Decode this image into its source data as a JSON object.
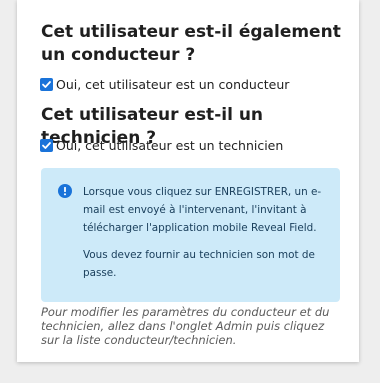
{
  "driver_section": {
    "heading": "Cet utilisateur est-il également un conducteur ?",
    "checkbox_label": "Oui, cet utilisateur est un conducteur",
    "checked": true
  },
  "technician_section": {
    "heading": "Cet utilisateur est-il un technicien ?",
    "checkbox_label": "Oui, cet utilisateur est un technicien",
    "checked": true
  },
  "info_box": {
    "icon": "info-icon",
    "paragraph1": "Lorsque vous cliquez sur ENREGISTRER, un e-mail est envoyé à l'intervenant, l'invitant à télécharger l'application mobile Reveal Field.",
    "paragraph2": "Vous devez fournir au technicien son mot de passe.",
    "background_color": "#cdeaf9",
    "icon_color": "#1a73d9"
  },
  "footnote": "Pour modifier les paramètres du conducteur et du technicien, allez dans l'onglet Admin puis cliquez sur la liste conducteur/technicien.",
  "colors": {
    "checkbox": "#1a73d9"
  }
}
